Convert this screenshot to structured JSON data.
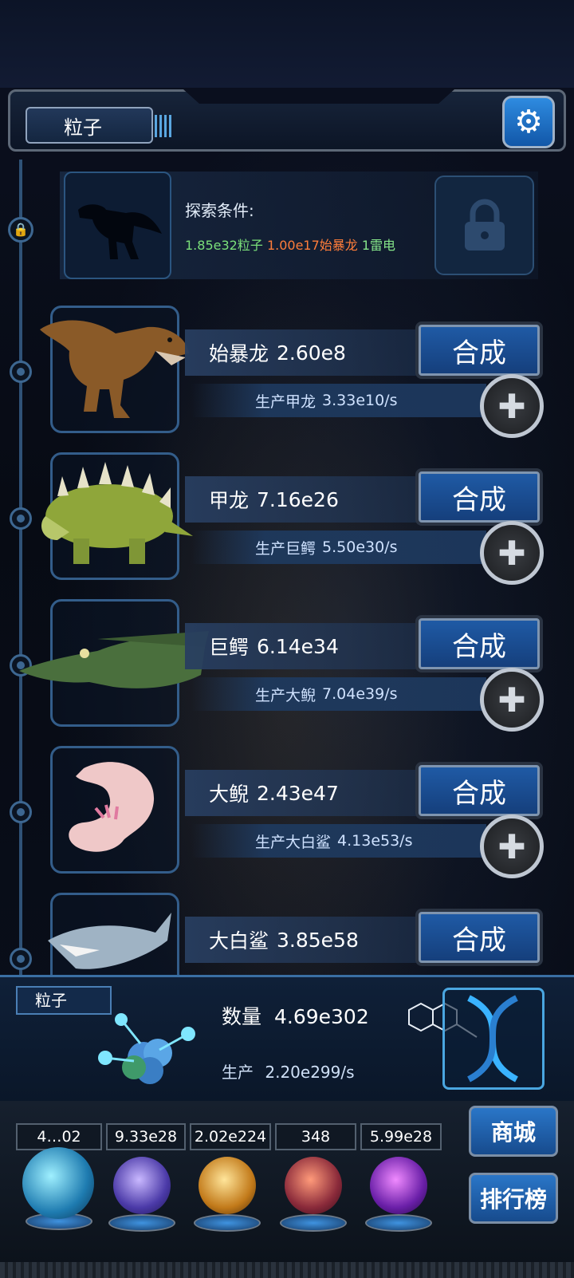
{
  "header": {
    "resource_tab": "粒子"
  },
  "locked_item": {
    "condition_label": "探索条件:",
    "conditions": [
      {
        "text": "1.85e32粒子",
        "color": "#7be07a"
      },
      {
        "text": "1.00e17始暴龙",
        "color": "#ff7d3a"
      },
      {
        "text": "1雷电",
        "color": "#86e68a"
      }
    ]
  },
  "creatures": [
    {
      "name": "始暴龙",
      "count": "2.60e8",
      "produce_label": "生产甲龙",
      "produce_rate": "3.33e10/s",
      "merge_label": "合成"
    },
    {
      "name": "甲龙",
      "count": "7.16e26",
      "produce_label": "生产巨鳄",
      "produce_rate": "5.50e30/s",
      "merge_label": "合成"
    },
    {
      "name": "巨鳄",
      "count": "6.14e34",
      "produce_label": "生产大鲵",
      "produce_rate": "7.04e39/s",
      "merge_label": "合成"
    },
    {
      "name": "大鲵",
      "count": "2.43e47",
      "produce_label": "生产大白鲨",
      "produce_rate": "4.13e53/s",
      "merge_label": "合成"
    },
    {
      "name": "大白鲨",
      "count": "3.85e58",
      "merge_label": "合成"
    }
  ],
  "bottom_panel": {
    "tab": "粒子",
    "quantity_label": "数量",
    "quantity_value": "4.69e302",
    "produce_label": "生产",
    "produce_value": "2.20e299/s"
  },
  "currencies": [
    "4…02",
    "9.33e28",
    "2.02e224",
    "348",
    "5.99e28"
  ],
  "side_buttons": {
    "shop": "商城",
    "ranking": "排行榜"
  },
  "colors": {
    "accent": "#1f5aa5",
    "frame": "#335d8a"
  }
}
